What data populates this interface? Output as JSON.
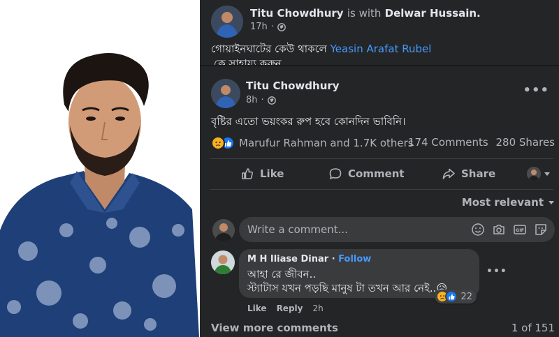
{
  "shared_post": {
    "author": "Titu Chowdhury",
    "with_text": "is with",
    "tagged": "Delwar Hussain.",
    "time": "17h",
    "text_before_link": "গোয়াইনঘাটের কেউ থাকলে",
    "link": "Yeasin Arafat Rubel",
    "text_after": "কে সাহায্য করুন...."
  },
  "post": {
    "author": "Titu Chowdhury",
    "time": "8h",
    "more": "•••",
    "text": "বৃষ্টির এতো ভয়ংকর রুপ হবে কোনদিন ভাবিনি।",
    "reaction_summary": "Marufur Rahman and 1.7K others",
    "comments_count": "174 Comments",
    "shares_count": "280 Shares",
    "actions": {
      "like": "Like",
      "comment": "Comment",
      "share": "Share"
    },
    "sort_label": "Most relevant"
  },
  "comment_input": {
    "placeholder": "Write a comment..."
  },
  "comment": {
    "author": "M H Iliase Dinar",
    "separator": "·",
    "follow": "Follow",
    "line1": "আহা রে জীবন..",
    "line2": "স্ট্যাটাস যখন পড়ছি মানুষ টা তখন আর নেই..😥",
    "reaction_count": "22",
    "like": "Like",
    "reply": "Reply",
    "time": "2h",
    "more": "•••"
  },
  "footer": {
    "view_more": "View more comments",
    "page_count": "1 of 151"
  },
  "colors": {
    "panel_bg": "#242526",
    "link": "#4599ff",
    "text_primary": "#e4e6eb",
    "text_secondary": "#b0b3b8",
    "like_blue": "#1877f2",
    "sad_yellow": "#f7b125"
  }
}
